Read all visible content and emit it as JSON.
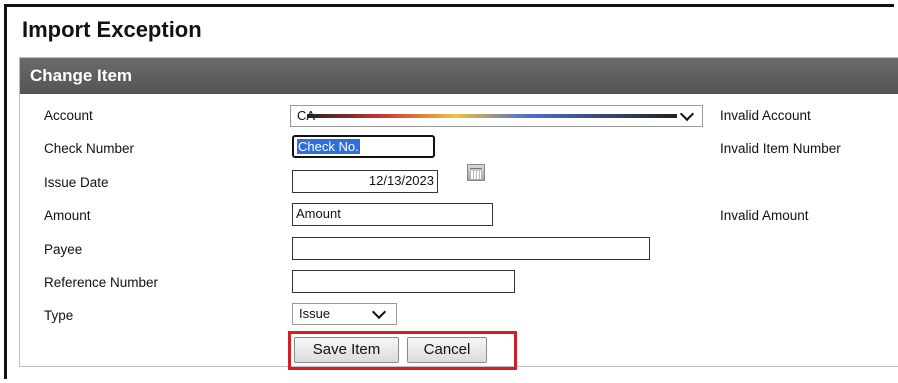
{
  "page": {
    "title": "Import Exception"
  },
  "panel": {
    "header": "Change Item"
  },
  "form": {
    "account": {
      "label": "Account",
      "value": "CA",
      "error": "Invalid Account"
    },
    "check_number": {
      "label": "Check Number",
      "value": "Check No.",
      "error": "Invalid Item Number"
    },
    "issue_date": {
      "label": "Issue Date",
      "value": "12/13/2023",
      "icon": "calendar-icon"
    },
    "amount": {
      "label": "Amount",
      "value": "Amount",
      "error": "Invalid Amount"
    },
    "payee": {
      "label": "Payee",
      "value": ""
    },
    "reference_number": {
      "label": "Reference Number",
      "value": ""
    },
    "type": {
      "label": "Type",
      "value": "Issue"
    }
  },
  "buttons": {
    "save": "Save Item",
    "cancel": "Cancel"
  },
  "colors": {
    "header_bg": "#5f5f5f",
    "highlight": "#d21f26"
  }
}
